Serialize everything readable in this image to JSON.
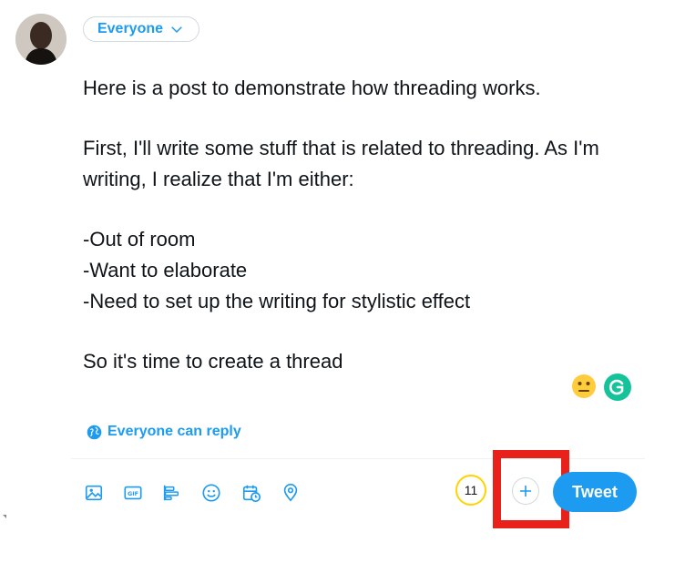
{
  "composer": {
    "audience_label": "Everyone",
    "lines": [
      "Here is a post to demonstrate how threading works.",
      "First, I'll write some stuff that is related to threading. As I'm writing, I realize that I'm either:",
      "-Out of room",
      "-Want to elaborate",
      "-Need to set up the writing for stylistic effect",
      "So it's time to create a thread"
    ],
    "reply_setting": "Everyone can reply"
  },
  "toolbar": {
    "icons": [
      "image-icon",
      "gif-icon",
      "poll-icon",
      "emoji-icon",
      "schedule-icon",
      "location-icon"
    ],
    "char_counter": "11",
    "tweet_label": "Tweet"
  },
  "colors": {
    "accent": "#1d9bf0",
    "counter_ring": "#ffd400",
    "highlight": "#e8211b",
    "grammarly": "#15c39a"
  }
}
